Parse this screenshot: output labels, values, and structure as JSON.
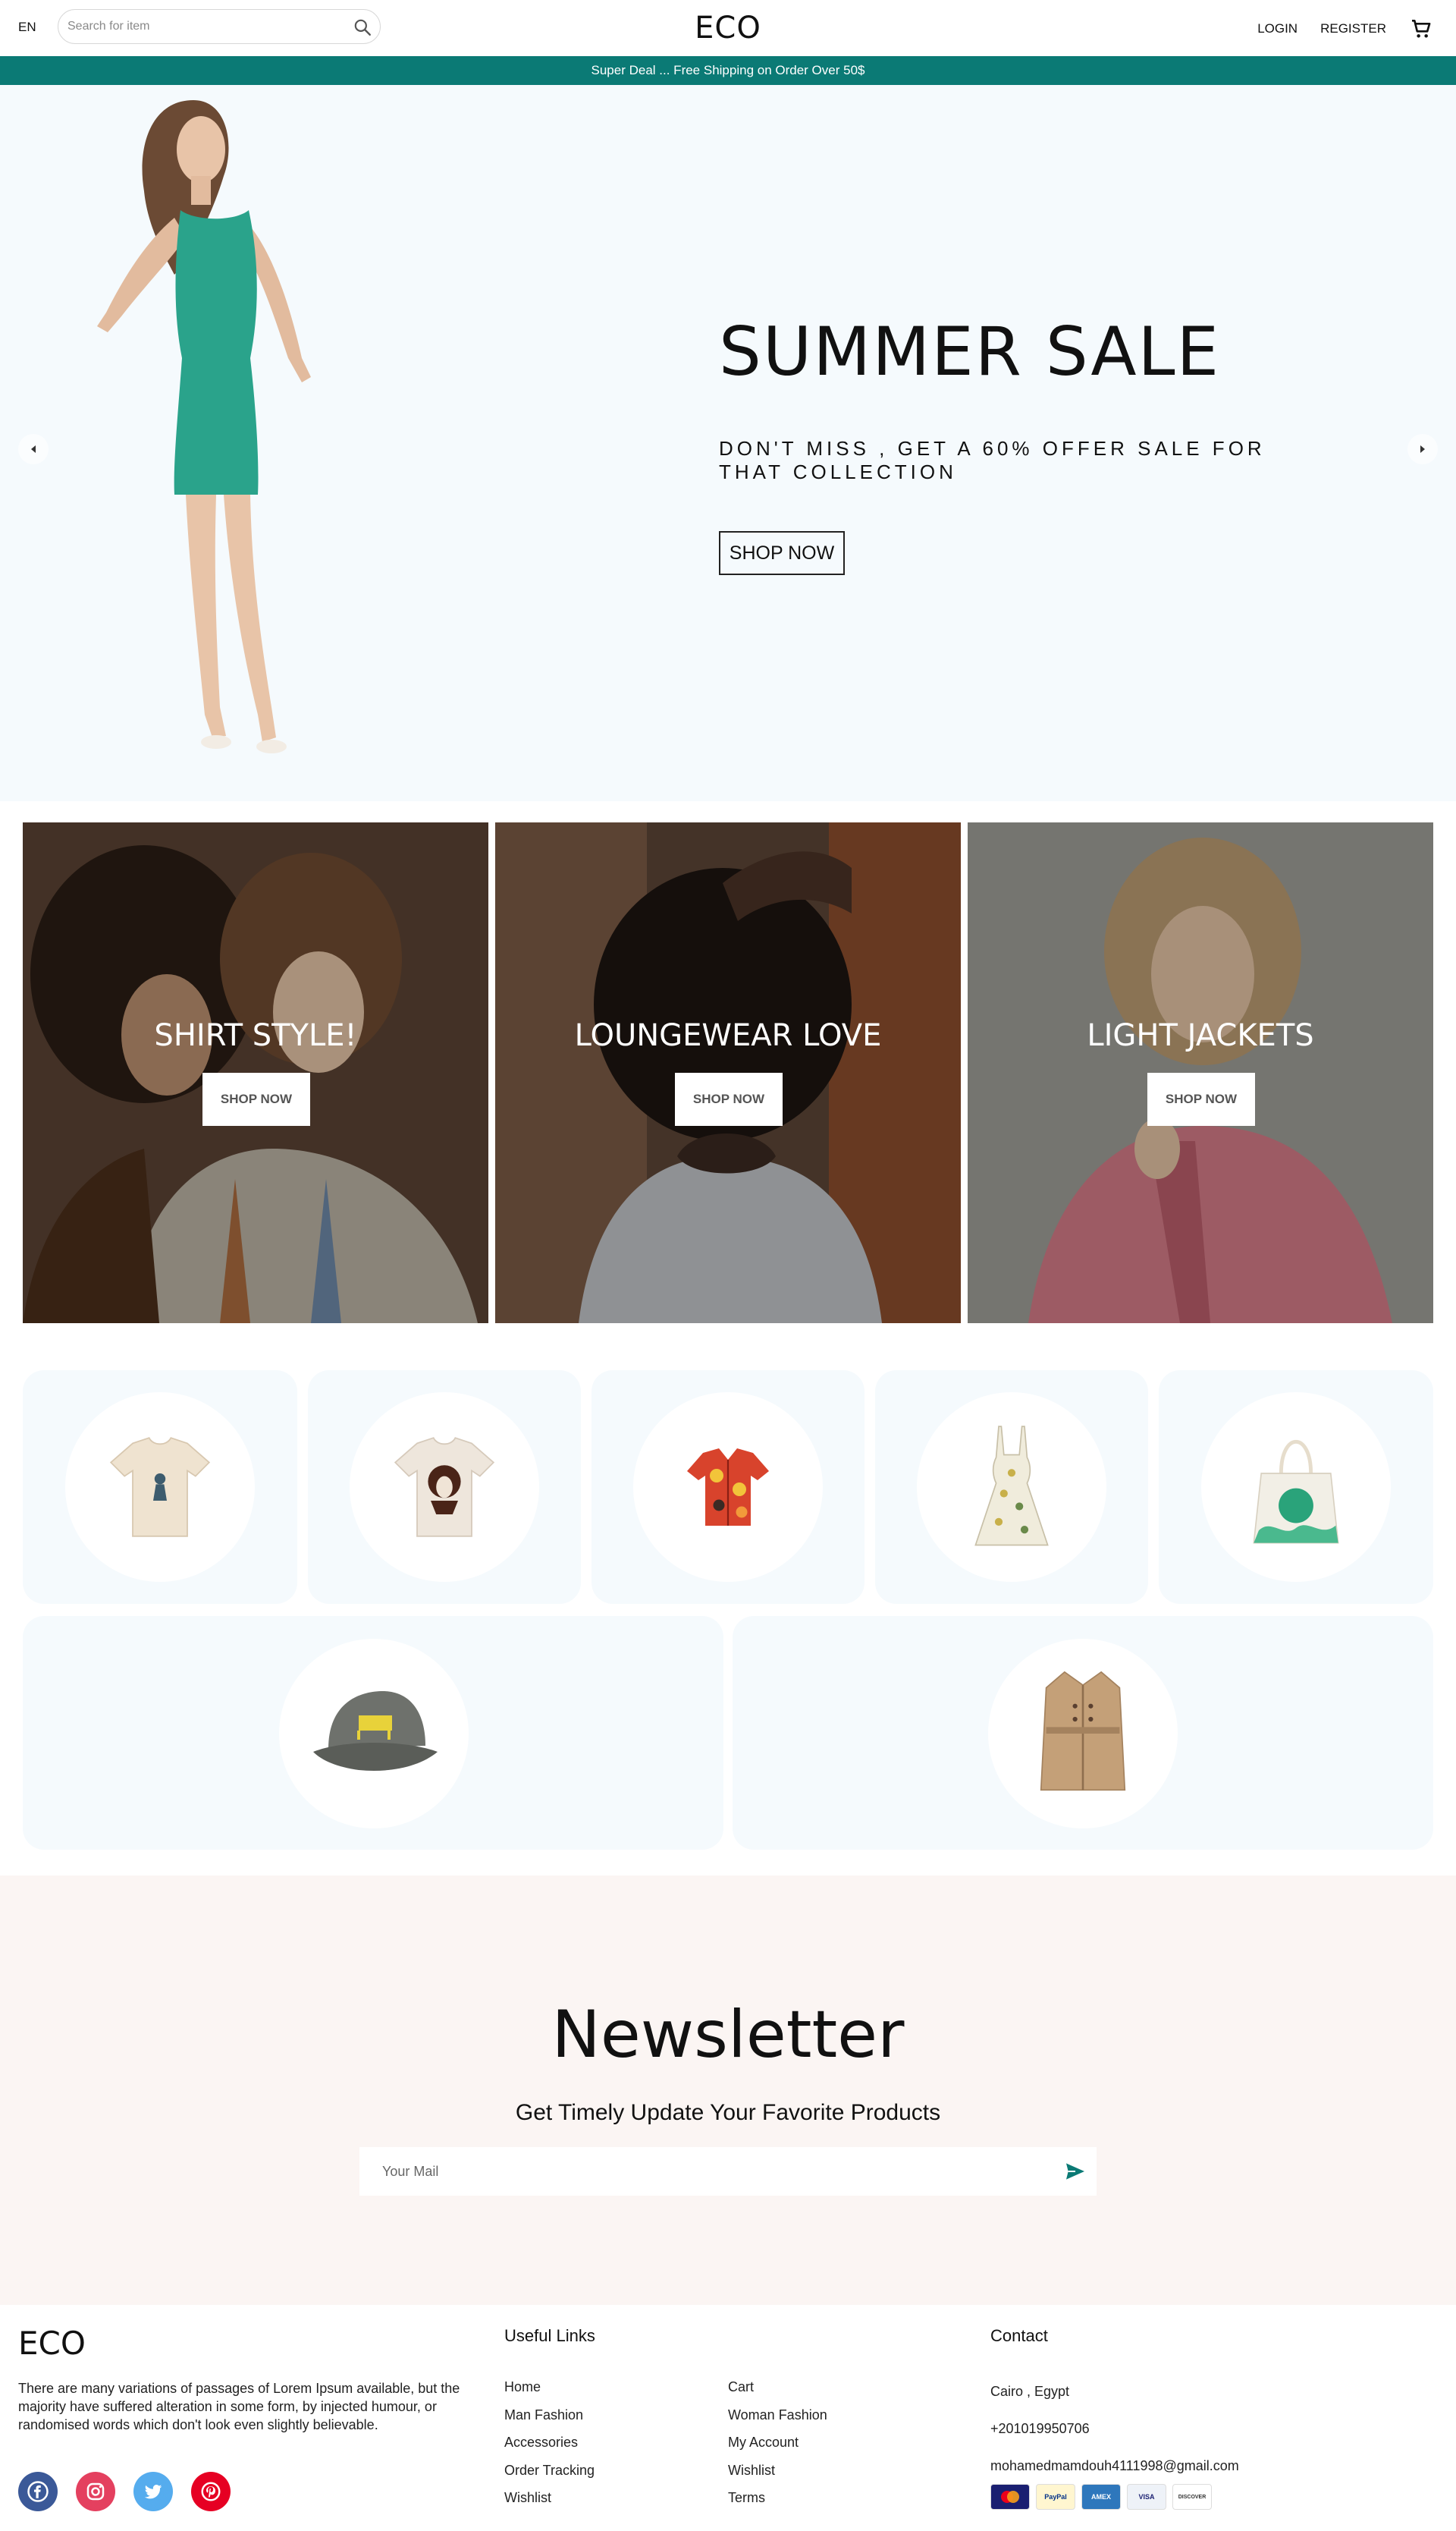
{
  "header": {
    "lang": "EN",
    "search_placeholder": "Search for item",
    "logo": "ECO",
    "login": "LOGIN",
    "register": "REGISTER"
  },
  "announcement": "Super Deal ... Free Shipping on Order Over 50$",
  "hero": {
    "title": "SUMMER SALE",
    "subtitle": "DON'T MISS , GET A 60% OFFER SALE FOR THAT COLLECTION",
    "button": "SHOP NOW"
  },
  "categories": [
    {
      "title": "SHIRT STYLE!",
      "button": "SHOP NOW"
    },
    {
      "title": "LOUNGEWEAR LOVE",
      "button": "SHOP NOW"
    },
    {
      "title": "LIGHT JACKETS",
      "button": "SHOP NOW"
    }
  ],
  "products": [
    {
      "icon": "tshirt-icon"
    },
    {
      "icon": "printed-tshirt-icon"
    },
    {
      "icon": "hawaiian-shirt-icon"
    },
    {
      "icon": "sundress-icon"
    },
    {
      "icon": "tote-bag-icon"
    },
    {
      "icon": "cap-icon"
    },
    {
      "icon": "trench-coat-icon"
    }
  ],
  "newsletter": {
    "title": "Newsletter",
    "description": "Get Timely Update Your Favorite Products",
    "placeholder": "Your Mail"
  },
  "footer": {
    "logo": "ECO",
    "description": "There are many variations of passages of Lorem Ipsum available, but the majority have suffered alteration in some form, by injected humour, or randomised words which don't look even slightly believable.",
    "useful_links_title": "Useful Links",
    "links_col1": [
      "Home",
      "Man Fashion",
      "Accessories",
      "Order Tracking",
      "Wishlist"
    ],
    "links_col2": [
      "Cart",
      "Woman Fashion",
      "My Account",
      "Wishlist",
      "Terms"
    ],
    "contact_title": "Contact",
    "contact": {
      "address": "Cairo , Egypt",
      "phone": "+201019950706",
      "email": "mohamedmamdouh4111998@gmail.com"
    },
    "social": [
      "facebook-icon",
      "instagram-icon",
      "twitter-icon",
      "pinterest-icon"
    ],
    "payments": [
      "MC",
      "PayPal",
      "AMEX",
      "VISA",
      "DISCOVER"
    ]
  },
  "colors": {
    "accent": "#0b7a75",
    "hero_bg": "#f5fafd",
    "newsletter_bg": "#fbf5f3",
    "product_bg": "#f5fafd"
  }
}
